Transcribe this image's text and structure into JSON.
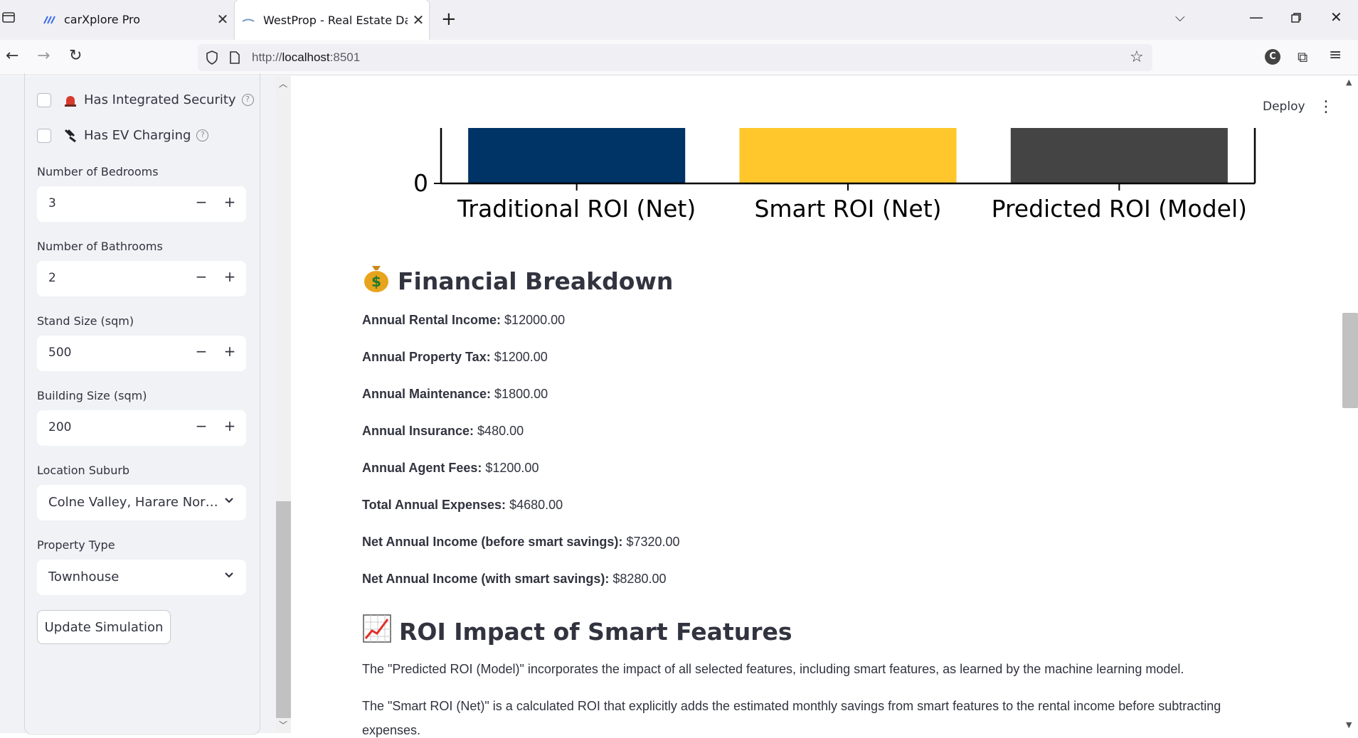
{
  "browser": {
    "tabs": [
      {
        "title": "carXplore Pro"
      },
      {
        "title": "WestProp - Real Estate Dashboa"
      }
    ],
    "url_scheme": "http://",
    "url_host": "localhost",
    "url_port": ":8501"
  },
  "sidebar": {
    "security_label": "Has Integrated Security",
    "ev_label": "Has EV Charging",
    "bedrooms": {
      "label": "Number of Bedrooms",
      "value": "3"
    },
    "bathrooms": {
      "label": "Number of Bathrooms",
      "value": "2"
    },
    "stand_size": {
      "label": "Stand Size (sqm)",
      "value": "500"
    },
    "building_size": {
      "label": "Building Size (sqm)",
      "value": "200"
    },
    "suburb": {
      "label": "Location Suburb",
      "value": "Colne Valley, Harare Nor…"
    },
    "property_type": {
      "label": "Property Type",
      "value": "Townhouse"
    },
    "update_label": "Update Simulation",
    "minus": "−",
    "plus": "+"
  },
  "header": {
    "deploy_label": "Deploy"
  },
  "chart_data": {
    "type": "bar",
    "categories": [
      "Traditional ROI (Net)",
      "Smart ROI (Net)",
      "Predicted ROI (Model)"
    ],
    "colors": [
      "#003366",
      "#ffc72c",
      "#444444"
    ],
    "yticks": [
      "0"
    ]
  },
  "financial": {
    "title": "Financial Breakdown",
    "items": [
      {
        "label": "Annual Rental Income:",
        "value": "$12000.00"
      },
      {
        "label": "Annual Property Tax:",
        "value": "$1200.00"
      },
      {
        "label": "Annual Maintenance:",
        "value": "$1800.00"
      },
      {
        "label": "Annual Insurance:",
        "value": "$480.00"
      },
      {
        "label": "Annual Agent Fees:",
        "value": "$1200.00"
      },
      {
        "label": "Total Annual Expenses:",
        "value": "$4680.00"
      },
      {
        "label": "Net Annual Income (before smart savings):",
        "value": "$7320.00"
      },
      {
        "label": "Net Annual Income (with smart savings):",
        "value": "$8280.00"
      }
    ]
  },
  "roi": {
    "title": "ROI Impact of Smart Features",
    "p1": "The \"Predicted ROI (Model)\" incorporates the impact of all selected features, including smart features, as learned by the machine learning model.",
    "p2": "The \"Smart ROI (Net)\" is a calculated ROI that explicitly adds the estimated monthly savings from smart features to the rental income before subtracting",
    "p3": "expenses."
  }
}
